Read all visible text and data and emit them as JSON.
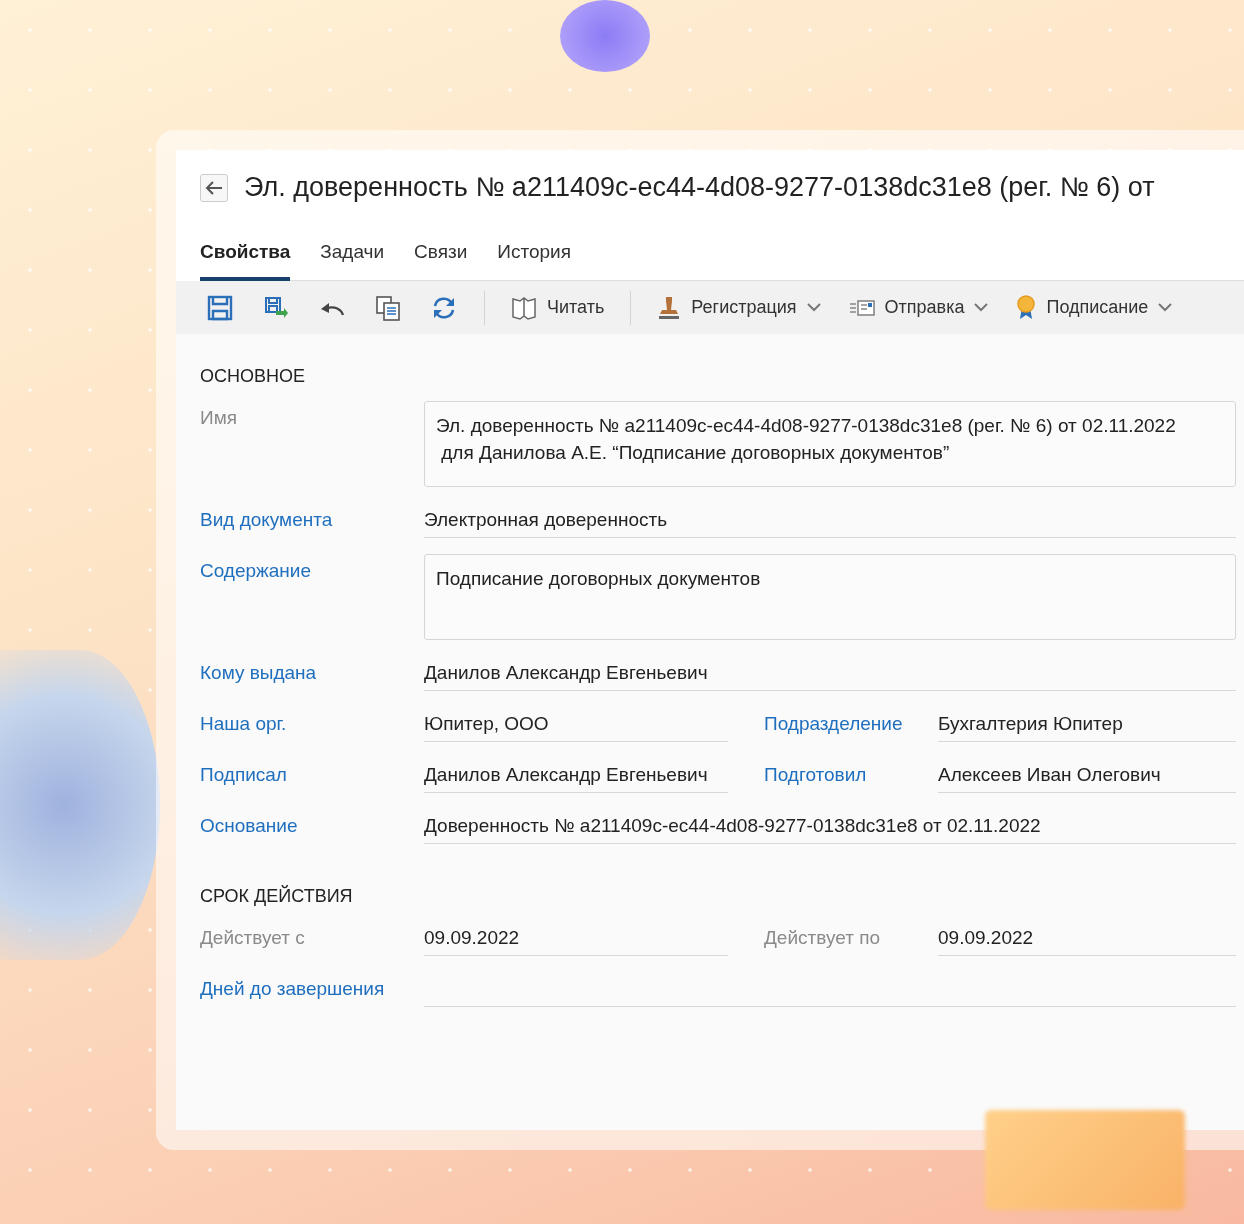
{
  "title": "Эл. доверенность № a211409c-ec44-4d08-9277-0138dc31e8 (рег. № 6) от",
  "tabs": [
    {
      "label": "Свойства",
      "selected": true
    },
    {
      "label": "Задачи",
      "selected": false
    },
    {
      "label": "Связи",
      "selected": false
    },
    {
      "label": "История",
      "selected": false
    }
  ],
  "toolbar": {
    "actions": [
      {
        "label": "Читать",
        "dropdown": false
      },
      {
        "label": "Регистрация",
        "dropdown": true
      },
      {
        "label": "Отправка",
        "dropdown": true
      },
      {
        "label": "Подписание",
        "dropdown": true
      }
    ]
  },
  "sections": [
    {
      "title": "ОСНОВНОЕ",
      "rows": [
        {
          "fields": [
            {
              "label": "Имя",
              "link": false,
              "kind": "multiline",
              "value": "Эл. доверенность № a211409c-ec44-4d08-9277-0138dc31e8 (рег. № 6) от 02.11.2022\n для Данилова А.Е. “Подписание договорных документов”"
            }
          ]
        },
        {
          "fields": [
            {
              "label": "Вид документа",
              "link": true,
              "kind": "line",
              "value": "Электронная доверенность"
            }
          ]
        },
        {
          "fields": [
            {
              "label": "Содержание",
              "link": true,
              "kind": "multiline",
              "value": "Подписание договорных документов"
            }
          ]
        },
        {
          "fields": [
            {
              "label": "Кому выдана",
              "link": true,
              "kind": "line",
              "value": "Данилов Александр Евгеньевич"
            }
          ]
        },
        {
          "fields": [
            {
              "label": "Наша орг.",
              "link": true,
              "kind": "line",
              "value": "Юпитер, ООО"
            },
            {
              "label": "Подразделение",
              "link": true,
              "kind": "line",
              "value": "Бухгалтерия Юпитер"
            }
          ]
        },
        {
          "fields": [
            {
              "label": "Подписал",
              "link": true,
              "kind": "line",
              "value": "Данилов Александр Евгеньевич"
            },
            {
              "label": "Подготовил",
              "link": true,
              "kind": "line",
              "value": "Алексеев Иван Олегович"
            }
          ]
        },
        {
          "fields": [
            {
              "label": "Основание",
              "link": true,
              "kind": "line",
              "value": "Доверенность № a211409c-ec44-4d08-9277-0138dc31e8 от 02.11.2022"
            }
          ]
        }
      ]
    },
    {
      "title": "СРОК ДЕЙСТВИЯ",
      "rows": [
        {
          "fields": [
            {
              "label": "Действует с",
              "link": false,
              "kind": "line",
              "value": "09.09.2022"
            },
            {
              "label": "Действует по",
              "link": false,
              "kind": "line",
              "value": "09.09.2022"
            }
          ]
        },
        {
          "fields": [
            {
              "label": "Дней до завершения",
              "link": true,
              "kind": "line"
            }
          ]
        }
      ]
    }
  ]
}
